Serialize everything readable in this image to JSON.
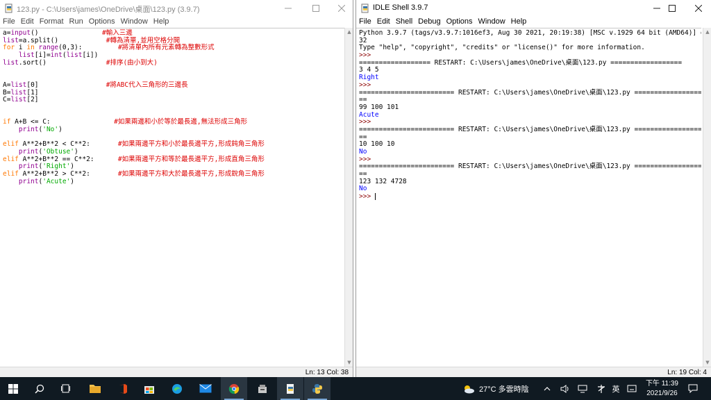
{
  "editor": {
    "title": "123.py - C:\\Users\\james\\OneDrive\\桌面\\123.py (3.9.7)",
    "menus": [
      "File",
      "Edit",
      "Format",
      "Run",
      "Options",
      "Window",
      "Help"
    ],
    "status": "Ln: 13   Col: 38",
    "lines": [
      [
        [
          "dim",
          "a="
        ],
        [
          "bi",
          "input"
        ],
        [
          "dim",
          "()                "
        ],
        [
          "cm",
          "#輸入三邊"
        ]
      ],
      [
        [
          "bi",
          "list"
        ],
        [
          "dim",
          "=a.split()            "
        ],
        [
          "cm",
          "#轉為清單,並用空格分開"
        ]
      ],
      [
        [
          "kw",
          "for"
        ],
        [
          "dim",
          " i "
        ],
        [
          "kw",
          "in"
        ],
        [
          "dim",
          " "
        ],
        [
          "bi",
          "range"
        ],
        [
          "dim",
          "(0,3):         "
        ],
        [
          "cm",
          "#將清單內所有元素轉為整數形式"
        ]
      ],
      [
        [
          "dim",
          "    "
        ],
        [
          "bi",
          "list"
        ],
        [
          "dim",
          "[i]="
        ],
        [
          "bi",
          "int"
        ],
        [
          "dim",
          "("
        ],
        [
          "bi",
          "list"
        ],
        [
          "dim",
          "[i])"
        ]
      ],
      [
        [
          "bi",
          "list"
        ],
        [
          "dim",
          ".sort()               "
        ],
        [
          "cm",
          "#排序(由小到大)"
        ]
      ],
      [
        [
          "dim",
          ""
        ]
      ],
      [
        [
          "dim",
          ""
        ]
      ],
      [
        [
          "dim",
          "A="
        ],
        [
          "bi",
          "list"
        ],
        [
          "dim",
          "[0]                 "
        ],
        [
          "cm",
          "#將ABC代入三角形的三邊長"
        ]
      ],
      [
        [
          "dim",
          "B="
        ],
        [
          "bi",
          "list"
        ],
        [
          "dim",
          "[1]"
        ]
      ],
      [
        [
          "dim",
          "C="
        ],
        [
          "bi",
          "list"
        ],
        [
          "dim",
          "[2]"
        ]
      ],
      [
        [
          "dim",
          ""
        ]
      ],
      [
        [
          "dim",
          ""
        ]
      ],
      [
        [
          "kw",
          "if"
        ],
        [
          "dim",
          " A+B <= C:                "
        ],
        [
          "cm",
          "#如果兩邊和小於等於最長邊,無法形成三角形"
        ]
      ],
      [
        [
          "dim",
          "    "
        ],
        [
          "bi",
          "print"
        ],
        [
          "dim",
          "("
        ],
        [
          "str",
          "'No'"
        ],
        [
          "dim",
          ")"
        ]
      ],
      [
        [
          "dim",
          ""
        ]
      ],
      [
        [
          "kw",
          "elif"
        ],
        [
          "dim",
          " A**2+B**2 < C**2:       "
        ],
        [
          "cm",
          "#如果兩邊平方和小於最長邊平方,形成鈍角三角形"
        ]
      ],
      [
        [
          "dim",
          "    "
        ],
        [
          "bi",
          "print"
        ],
        [
          "dim",
          "("
        ],
        [
          "str",
          "'Obtuse'"
        ],
        [
          "dim",
          ")"
        ]
      ],
      [
        [
          "kw",
          "elif"
        ],
        [
          "dim",
          " A**2+B**2 == C**2:      "
        ],
        [
          "cm",
          "#如果兩邊平方和等於最長邊平方,形成直角三角形"
        ]
      ],
      [
        [
          "dim",
          "    "
        ],
        [
          "bi",
          "print"
        ],
        [
          "dim",
          "("
        ],
        [
          "str",
          "'Right'"
        ],
        [
          "dim",
          ")"
        ]
      ],
      [
        [
          "kw",
          "elif"
        ],
        [
          "dim",
          " A**2+B**2 > C**2:       "
        ],
        [
          "cm",
          "#如果兩邊平方和大於最長邊平方,形成銳角三角形"
        ]
      ],
      [
        [
          "dim",
          "    "
        ],
        [
          "bi",
          "print"
        ],
        [
          "dim",
          "("
        ],
        [
          "str",
          "'Acute'"
        ],
        [
          "dim",
          ")"
        ]
      ]
    ]
  },
  "shell": {
    "title": "IDLE Shell 3.9.7",
    "menus": [
      "File",
      "Edit",
      "Shell",
      "Debug",
      "Options",
      "Window",
      "Help"
    ],
    "status": "Ln: 19   Col: 4",
    "lines": [
      [
        [
          "dim",
          "Python 3.9.7 (tags/v3.9.7:1016ef3, Aug 30 2021, 20:19:38) [MSC v.1929 64 bit (AMD64)] on win"
        ]
      ],
      [
        [
          "dim",
          "32"
        ]
      ],
      [
        [
          "dim",
          "Type \"help\", \"copyright\", \"credits\" or \"license()\" for more information."
        ]
      ],
      [
        [
          "prm",
          ">>> "
        ]
      ],
      [
        [
          "dim",
          "================== RESTART: C:\\Users\\james\\OneDrive\\桌面\\123.py =================="
        ]
      ],
      [
        [
          "dim",
          "3 4 5"
        ]
      ],
      [
        [
          "out",
          "Right"
        ]
      ],
      [
        [
          "prm",
          ">>> "
        ]
      ],
      [
        [
          "dim",
          "======================== RESTART: C:\\Users\\james\\OneDrive\\桌面\\123.py ======================"
        ]
      ],
      [
        [
          "dim",
          "=="
        ]
      ],
      [
        [
          "dim",
          "99 100 101"
        ]
      ],
      [
        [
          "out",
          "Acute"
        ]
      ],
      [
        [
          "prm",
          ">>> "
        ]
      ],
      [
        [
          "dim",
          "======================== RESTART: C:\\Users\\james\\OneDrive\\桌面\\123.py ======================"
        ]
      ],
      [
        [
          "dim",
          "=="
        ]
      ],
      [
        [
          "dim",
          "10 100 10"
        ]
      ],
      [
        [
          "out",
          "No"
        ]
      ],
      [
        [
          "prm",
          ">>> "
        ]
      ],
      [
        [
          "dim",
          "======================== RESTART: C:\\Users\\james\\OneDrive\\桌面\\123.py ======================"
        ]
      ],
      [
        [
          "dim",
          "=="
        ]
      ],
      [
        [
          "dim",
          "123 132 4728"
        ]
      ],
      [
        [
          "out",
          "No"
        ]
      ],
      [
        [
          "prm",
          ">>> "
        ]
      ]
    ]
  },
  "taskbar": {
    "weather": "27°C  多雲時陰",
    "ime": "英",
    "time": "下午 11:39",
    "date": "2021/9/26"
  },
  "colors": {
    "keyword": "#ff7700",
    "builtin": "#900090",
    "string": "#00aa00",
    "comment": "#dd0000",
    "output": "#0000ff",
    "taskbar": "#101a22"
  }
}
